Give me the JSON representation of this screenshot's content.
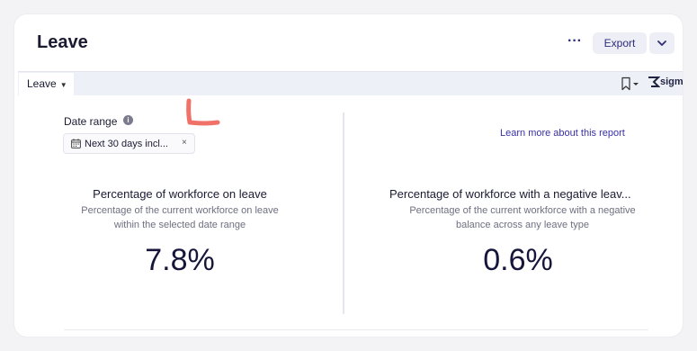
{
  "header": {
    "title": "Leave",
    "more_label": "···",
    "export_label": "Export"
  },
  "toolbar": {
    "tab_label": "Leave",
    "brand_label": "sigm",
    "icons": [
      "bookmark-icon",
      "chevron-down-icon",
      "sigma-logo"
    ]
  },
  "filter": {
    "label": "Date range",
    "info_glyph": "i",
    "chip_value": "Next 30 days incl...",
    "clear_glyph": "×"
  },
  "learn_more": "Learn more about this report",
  "metrics": [
    {
      "title": "Percentage of workforce on leave",
      "subtitle_line1": "Percentage of the current workforce on leave",
      "subtitle_line2": "within the selected date range",
      "value": "7.8%"
    },
    {
      "title": "Percentage of workforce with a negative leav...",
      "subtitle_line1": "Percentage of the current workforce with a negative",
      "subtitle_line2": "balance across any leave type",
      "value": "0.6%"
    }
  ],
  "colors": {
    "accent": "#2b2c7a",
    "link": "#3730a3",
    "annotation": "#f07167"
  }
}
